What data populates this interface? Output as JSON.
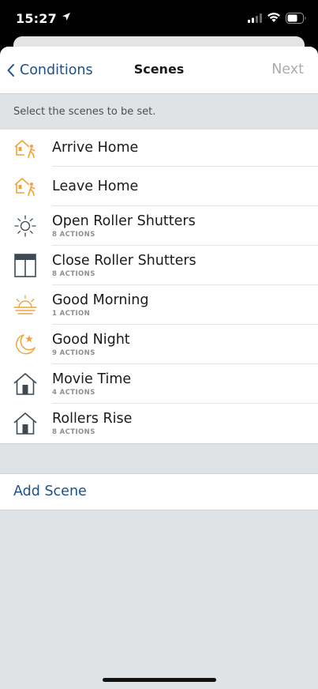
{
  "status_bar": {
    "time": "15:27"
  },
  "nav": {
    "back_label": "Conditions",
    "title": "Scenes",
    "next_label": "Next"
  },
  "section_header": "Select the scenes to be set.",
  "scenes": [
    {
      "title": "Arrive Home",
      "subtitle": "",
      "icon": "house-person-icon"
    },
    {
      "title": "Leave Home",
      "subtitle": "",
      "icon": "house-person-icon"
    },
    {
      "title": "Open Roller Shutters",
      "subtitle": "8 ACTIONS",
      "icon": "sun-icon"
    },
    {
      "title": "Close Roller Shutters",
      "subtitle": "8 ACTIONS",
      "icon": "window-shutter-icon"
    },
    {
      "title": "Good Morning",
      "subtitle": "1 ACTION",
      "icon": "sunrise-icon"
    },
    {
      "title": "Good Night",
      "subtitle": "9 ACTIONS",
      "icon": "moon-star-icon"
    },
    {
      "title": "Movie Time",
      "subtitle": "4 ACTIONS",
      "icon": "house-icon"
    },
    {
      "title": "Rollers Rise",
      "subtitle": "8 ACTIONS",
      "icon": "house-icon"
    }
  ],
  "add_scene_label": "Add Scene",
  "colors": {
    "accent": "#1c4f8c",
    "icon_orange": "#f0a33a",
    "icon_dark": "#3d4a55",
    "disabled": "#a9adb1"
  }
}
